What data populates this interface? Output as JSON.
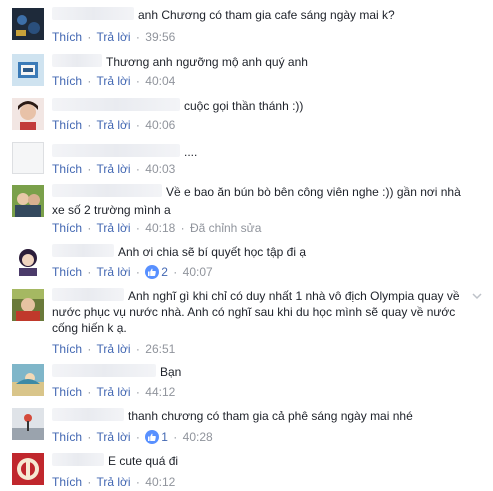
{
  "actions": {
    "like": "Thích",
    "reply": "Trả lời",
    "separator": "·",
    "edited": "Đã chỉnh sửa"
  },
  "comments": [
    {
      "text": "anh Chương có tham gia cafe sáng ngày mai k?",
      "time": "39:56",
      "avatar": "profile-photo"
    },
    {
      "text": "Thương anh ngưỡng mộ anh quý anh",
      "time": "40:04",
      "avatar": "profile-photo"
    },
    {
      "text": "cuộc gọi thần thánh :))",
      "time": "40:06",
      "avatar": "profile-photo"
    },
    {
      "text": "....",
      "time": "40:03",
      "avatar": "default-avatar"
    },
    {
      "text_line1": "Về e bao ăn bún bò bên công viên nghe :)) gần nơi nhà",
      "text_line2": "xe số 2 trường mình a",
      "time": "40:18",
      "edited": true,
      "avatar": "profile-photo"
    },
    {
      "text": "Anh ơi chia sẽ bí quyết học tập đi ạ",
      "time": "40:07",
      "likes": "2",
      "avatar": "profile-photo"
    },
    {
      "text_line1": "Anh nghĩ gì khi chỉ có duy nhất 1 nhà vô địch Olympia quay về",
      "text_line2": "nước phục vụ nước nhà. Anh có nghĩ sau khi du học mình sẽ quay về nước",
      "text_line3": "cống hiến k ạ.",
      "time": "26:51",
      "avatar": "profile-photo"
    },
    {
      "text": "Bạn",
      "time": "44:12",
      "avatar": "profile-photo"
    },
    {
      "text": "thanh chương có tham gia cả phê sáng ngày mai nhé",
      "time": "40:28",
      "likes": "1",
      "avatar": "profile-photo"
    },
    {
      "text": "E cute quá đi",
      "time": "40:12",
      "avatar": "profile-photo"
    }
  ],
  "colors": {
    "link": "#4267b2",
    "meta": "#90949c",
    "text": "#1d2129",
    "like_badge": "#5890ff"
  }
}
